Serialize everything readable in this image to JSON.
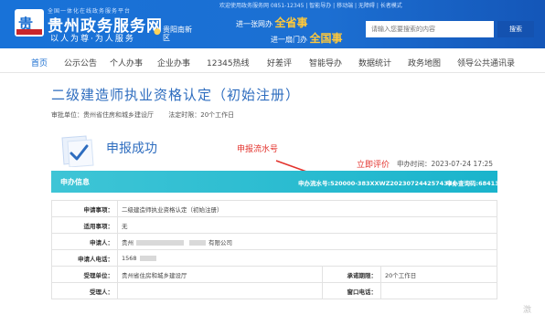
{
  "header": {
    "logo_mark": "贵",
    "brand_small": "全国一体化在线政务服务平台",
    "brand_title": "贵州政务服务网",
    "brand_slogan": "以人为尊·为人服务",
    "region_icon": "location-icon",
    "region": "贵阳南新区",
    "topline_text": "欢迎使用政务服务网 0851-12345 | 智能导办 | 移动端 | 无障碍 | 长者模式",
    "topline_badge": "长者模式",
    "service_line1_prefix": "进一张网办",
    "service_line1_highlight": "全省事",
    "service_line2_prefix": "进一扇门办",
    "service_line2_highlight": "全国事",
    "search_placeholder": "请输入您要搜索的内容",
    "search_button": "搜索",
    "colors": {
      "header_bg": "#1872d8",
      "highlight": "#ffc83a"
    }
  },
  "nav": {
    "items": [
      "首页",
      "公示公告",
      "个人办事",
      "企业办事",
      "12345热线",
      "好差评",
      "智能导办",
      "数据统计",
      "政务地图",
      "领导公共通讯录"
    ],
    "active": "首页"
  },
  "main": {
    "title": "二级建造师执业资格认定（初始注册）",
    "approval_unit": "审批单位：贵州省住房和城乡建设厅",
    "time_limit": "法定时限：20个工作日",
    "success_icon": "check-document-icon",
    "success_text": "申报成功",
    "annotation": "申报流水号",
    "rate_link": "立即评价",
    "apply_time": "申办时间：2023-07-24 17:25",
    "info_label": "申办信息",
    "flow_no": "申办流水号:520000-383XXWZ2023072442574324",
    "query_code": "申办查询码:684139"
  },
  "table": {
    "rows": [
      {
        "label": "申请事项：",
        "value": "二级建造师执业资格认定（初始注册）"
      },
      {
        "label": "适用事项：",
        "value": "无"
      },
      {
        "label": "申请人：",
        "value_prefix": "贵州",
        "value_suffix": "有限公司"
      },
      {
        "label": "申请人电话：",
        "value": "1568"
      },
      {
        "label": "受理单位：",
        "value": "贵州省住房和城乡建设厅",
        "label2": "承诺期限：",
        "value2": "20个工作日"
      },
      {
        "label": "受理人：",
        "value": "",
        "label2": "窗口电话：",
        "value2": ""
      }
    ]
  },
  "watermark": "激"
}
